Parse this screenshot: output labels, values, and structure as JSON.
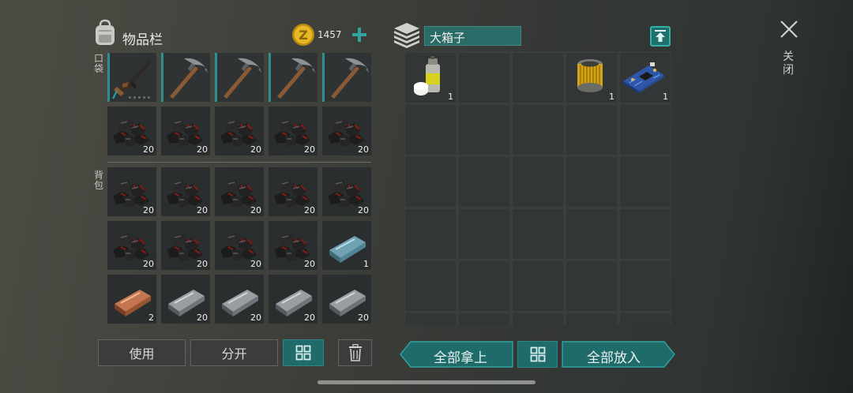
{
  "inventory": {
    "title": "物品栏",
    "currency_amount": "1457",
    "pocket_label": "口袋",
    "backpack_label": "背包",
    "pocket_slots": [
      {
        "item": "rifle",
        "count": ""
      },
      {
        "item": "pickaxe",
        "count": ""
      },
      {
        "item": "pickaxe",
        "count": ""
      },
      {
        "item": "pickaxe",
        "count": ""
      },
      {
        "item": "pickaxe",
        "count": ""
      },
      {
        "item": "coal",
        "count": "20"
      },
      {
        "item": "coal",
        "count": "20"
      },
      {
        "item": "coal",
        "count": "20"
      },
      {
        "item": "coal",
        "count": "20"
      },
      {
        "item": "coal",
        "count": "20"
      }
    ],
    "backpack_slots": [
      {
        "item": "coal",
        "count": "20"
      },
      {
        "item": "coal",
        "count": "20"
      },
      {
        "item": "coal",
        "count": "20"
      },
      {
        "item": "coal",
        "count": "20"
      },
      {
        "item": "coal",
        "count": "20"
      },
      {
        "item": "coal",
        "count": "20"
      },
      {
        "item": "coal",
        "count": "20"
      },
      {
        "item": "coal",
        "count": "20"
      },
      {
        "item": "coal",
        "count": "20"
      },
      {
        "item": "steel-bar",
        "count": "1"
      },
      {
        "item": "copper-bar",
        "count": "2"
      },
      {
        "item": "iron-bar",
        "count": "20"
      },
      {
        "item": "iron-bar",
        "count": "20"
      },
      {
        "item": "iron-bar",
        "count": "20"
      },
      {
        "item": "iron-bar",
        "count": "20"
      }
    ],
    "use_label": "使用",
    "split_label": "分开"
  },
  "container": {
    "name": "大箱子",
    "slots": [
      {
        "item": "spray-can",
        "count": "1"
      },
      {
        "item": "",
        "count": ""
      },
      {
        "item": "",
        "count": ""
      },
      {
        "item": "filter",
        "count": "1"
      },
      {
        "item": "circuit-board",
        "count": "1"
      }
    ],
    "take_all_label": "全部拿上",
    "put_all_label": "全部放入"
  },
  "close_label": "关闭",
  "colors": {
    "accent": "#1e6b6a",
    "accent_light": "#2fa3a0",
    "coin": "#e2b323"
  }
}
